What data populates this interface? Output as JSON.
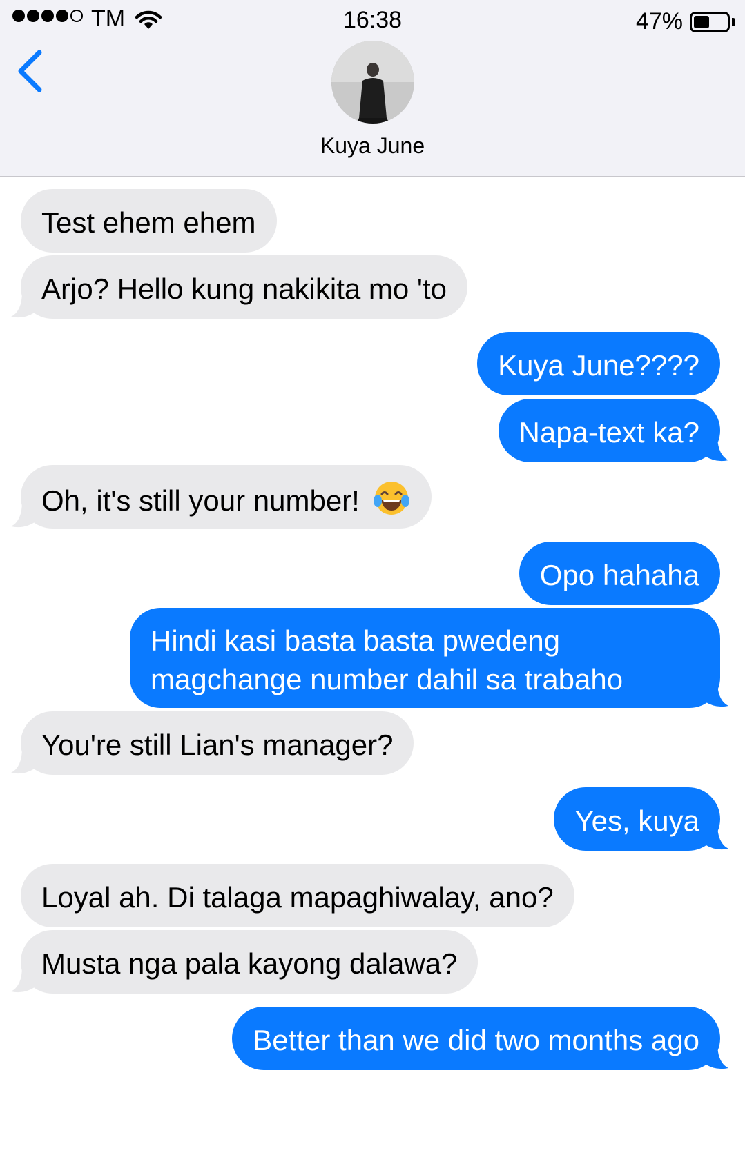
{
  "status_bar": {
    "carrier": "TM",
    "time": "16:38",
    "battery_percent": "47%",
    "battery_level": 0.47,
    "signal_bars_filled": 4,
    "signal_bars_total": 5
  },
  "contact": {
    "name": "Kuya June"
  },
  "colors": {
    "incoming_bubble": "#e9e9eb",
    "outgoing_bubble": "#0a7aff",
    "accent": "#0a7aff",
    "header_bg": "#f2f2f7"
  },
  "messages": [
    {
      "direction": "in",
      "text": "Test ehem ehem"
    },
    {
      "direction": "in",
      "text": "Arjo? Hello kung nakikita mo 'to"
    },
    {
      "direction": "out",
      "text": "Kuya June????"
    },
    {
      "direction": "out",
      "text": "Napa-text ka?"
    },
    {
      "direction": "in",
      "text": "Oh, it's still your number!",
      "emoji": "face-with-tears-of-joy-icon"
    },
    {
      "direction": "out",
      "text": "Opo hahaha"
    },
    {
      "direction": "out",
      "text": "Hindi kasi basta basta pwedeng magchange number dahil sa trabaho"
    },
    {
      "direction": "in",
      "text": "You're still Lian's manager?"
    },
    {
      "direction": "out",
      "text": "Yes, kuya"
    },
    {
      "direction": "in",
      "text": "Loyal ah. Di talaga mapaghiwalay, ano?"
    },
    {
      "direction": "in",
      "text": "Musta nga pala kayong dalawa?"
    },
    {
      "direction": "out",
      "text": "Better than we did two months ago"
    }
  ]
}
